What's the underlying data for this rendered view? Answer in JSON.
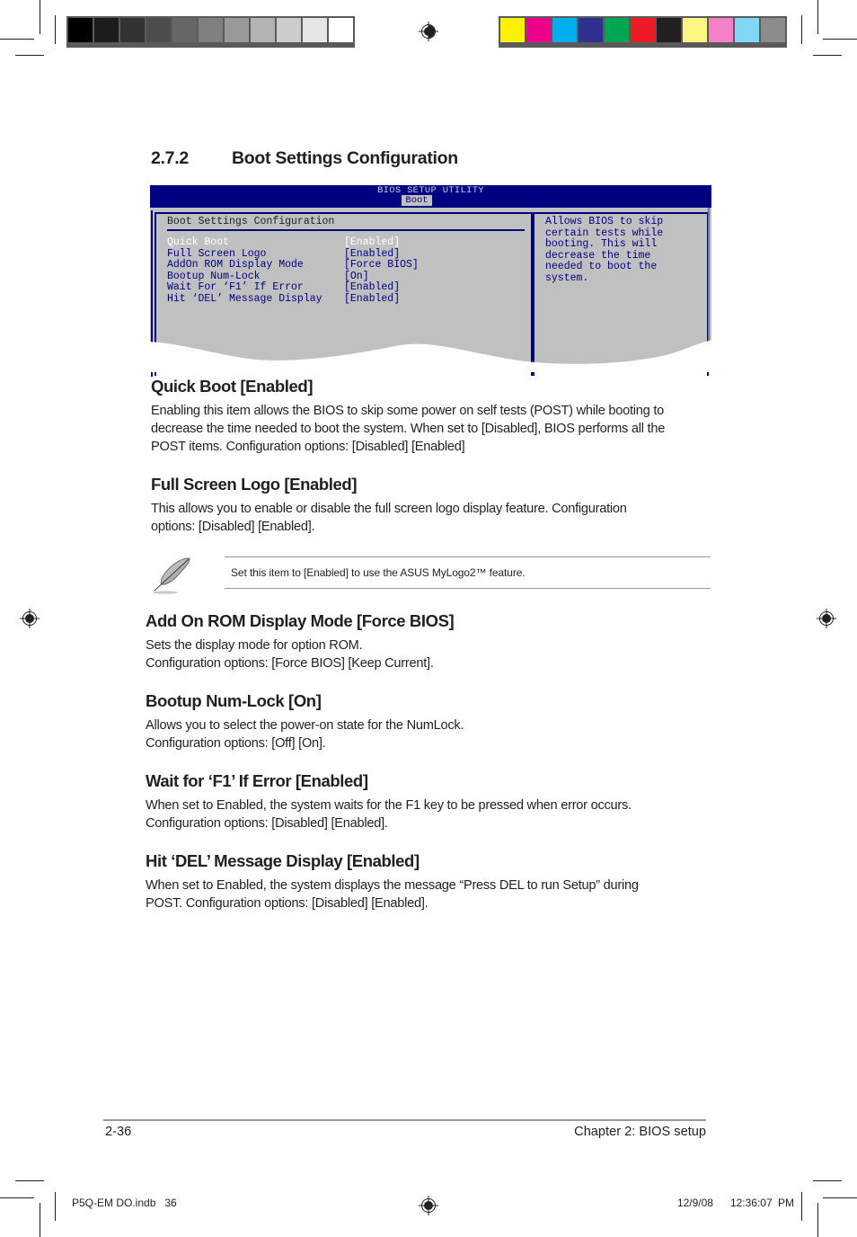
{
  "print_marks": {
    "gray_swatches": [
      "#000000",
      "#1c1c1c",
      "#333333",
      "#4d4d4d",
      "#666666",
      "#808080",
      "#999999",
      "#b3b3b3",
      "#cccccc",
      "#e6e6e6",
      "#ffffff"
    ],
    "color_swatches": [
      "#fff200",
      "#ec008c",
      "#00aeef",
      "#2e3192",
      "#00a651",
      "#ed1c24",
      "#231f20",
      "#fff681",
      "#f680c8",
      "#80d6f7",
      "#8c8c8c"
    ]
  },
  "section": {
    "number": "2.7.2",
    "title": "Boot Settings Configuration"
  },
  "bios": {
    "utility_title": "BIOS SETUP UTILITY",
    "active_tab": "Boot",
    "panel_title": "Boot Settings Configuration",
    "items": [
      {
        "label": "Quick Boot",
        "value": "[Enabled]",
        "selected": true
      },
      {
        "label": "Full Screen Logo",
        "value": "[Enabled]",
        "selected": false
      },
      {
        "label": "AddOn ROM Display Mode",
        "value": "[Force BIOS]",
        "selected": false
      },
      {
        "label": "Bootup Num-Lock",
        "value": "[On]",
        "selected": false
      },
      {
        "label": "Wait For ‘F1’ If Error",
        "value": "[Enabled]",
        "selected": false
      },
      {
        "label": "Hit ‘DEL’ Message Display",
        "value": "[Enabled]",
        "selected": false
      }
    ],
    "help_text": "Allows BIOS to skip\ncertain tests while\nbooting. This will\ndecrease the time\nneeded to boot the\nsystem.",
    "colors": {
      "header": "#000080",
      "body": "#c0c0c0",
      "item_text": "#000080",
      "selected_text": "#ffffff"
    }
  },
  "descriptions": [
    {
      "heading": "Quick Boot [Enabled]",
      "lines": [
        "Enabling this item allows the BIOS to skip some power on self tests (POST) while booting to",
        "decrease the time needed to boot the system. When set to [Disabled], BIOS performs all the",
        "POST items. Configuration options: [Disabled] [Enabled]"
      ]
    },
    {
      "heading": "Full Screen Logo [Enabled]",
      "lines": [
        "This allows you to enable or disable the full screen logo display feature. Configuration",
        "options: [Disabled] [Enabled]."
      ]
    },
    {
      "heading": "Add On ROM Display Mode [Force BIOS]",
      "lines": [
        "Sets the display mode for option ROM.",
        "Configuration options: [Force BIOS] [Keep Current]."
      ]
    },
    {
      "heading": "Bootup Num-Lock [On]",
      "lines": [
        "Allows you to select the power-on state for the NumLock.",
        "Configuration options: [Off] [On]."
      ]
    },
    {
      "heading": "Wait for ‘F1’ If Error [Enabled]",
      "lines": [
        "When set to Enabled, the system waits for the F1 key to be pressed when error occurs.",
        "Configuration options: [Disabled] [Enabled]."
      ]
    },
    {
      "heading": "Hit ‘DEL’ Message Display [Enabled]",
      "lines": [
        "When set to Enabled, the system displays the message “Press DEL to run Setup” during",
        "POST. Configuration options: [Disabled] [Enabled]."
      ]
    }
  ],
  "note": {
    "icon": "feather-pen-icon",
    "text": "Set this item to [Enabled] to use the ASUS MyLogo2™ feature."
  },
  "footer": {
    "page_number": "2-36",
    "chapter": "Chapter 2: BIOS setup"
  },
  "slug": {
    "file": "P5Q-EM DO.indb   36",
    "timestamp": "12/9/08   12:36:07 PM"
  }
}
